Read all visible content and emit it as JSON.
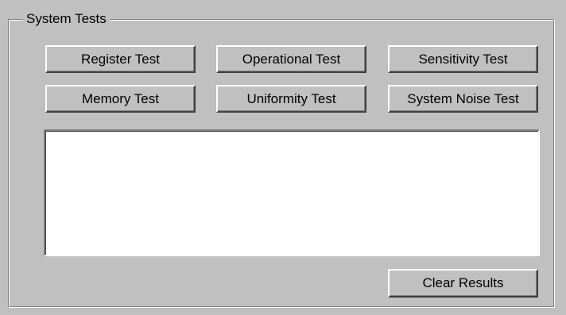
{
  "group": {
    "title": "System Tests"
  },
  "buttons": {
    "register": "Register Test",
    "operational": "Operational Test",
    "sensitivity": "Sensitivity Test",
    "memory": "Memory Test",
    "uniformity": "Uniformity Test",
    "noise": "System Noise Test",
    "clear": "Clear Results"
  },
  "results": {
    "text": ""
  },
  "colors": {
    "face": "#c0c0c0",
    "highlight": "#ffffff",
    "shadow": "#808080",
    "dark_shadow": "#404040",
    "field": "#ffffff"
  }
}
